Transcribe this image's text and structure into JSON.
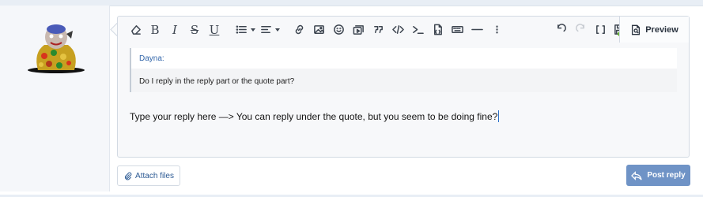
{
  "toolbar": {
    "buttons": [
      "clear-formatting",
      "bold",
      "italic",
      "strikethrough",
      "underline",
      "list",
      "align",
      "link",
      "image",
      "smilies",
      "media",
      "quote",
      "code",
      "inline-code",
      "insert-file",
      "keyboard",
      "horizontal-line",
      "more",
      "undo",
      "redo",
      "toggle-bbcode",
      "drafts"
    ],
    "bold_label": "B",
    "italic_label": "I",
    "strike_label": "S",
    "underline_label": "U",
    "preview_label": "Preview"
  },
  "quote": {
    "author": "Dayna:",
    "text": "Do I reply in the reply part or the quote part?"
  },
  "editor": {
    "content": "Type your reply here —> You can reply under the quote, but you seem to be doing fine?"
  },
  "actions": {
    "attach_label": "Attach files",
    "post_label": "Post reply"
  },
  "colors": {
    "accent": "#6f93c6",
    "link": "#2c5a94",
    "quote_author": "#3366aa"
  }
}
